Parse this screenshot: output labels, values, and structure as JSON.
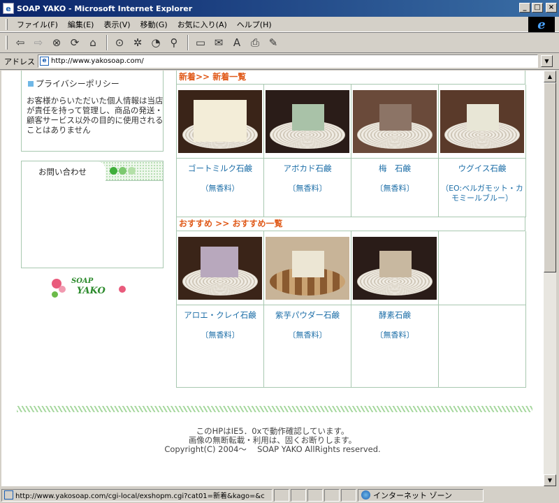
{
  "window": {
    "title": "SOAP YAKO - Microsoft Internet Explorer",
    "min_label": "_",
    "max_label": "□",
    "close_label": "×"
  },
  "menu": [
    "ファイル(F)",
    "編集(E)",
    "表示(V)",
    "移動(G)",
    "お気に入り(A)",
    "ヘルプ(H)"
  ],
  "toolbar_icons": [
    "back-icon",
    "forward-icon",
    "stop-icon",
    "refresh-icon",
    "home-icon",
    "search-icon",
    "favorites-icon",
    "history-icon",
    "channels-icon",
    "fullscreen-icon",
    "mail-icon",
    "font-icon",
    "print-icon",
    "edit-icon"
  ],
  "address": {
    "label": "アドレス",
    "url": "http://www.yakosoap.com/"
  },
  "sidebar": {
    "privacy_title": "プライバシーポリシー",
    "privacy_text": "お客様からいただいた個人情報は当店が責任を持って管理し、商品の発送・顧客サービス以外の目的に使用されることはありません",
    "contact_title": "お問い合わせ",
    "logo_top": "SOAP",
    "logo_bottom": "YAKO"
  },
  "sections": [
    {
      "title": "新着>> 新着一覧",
      "products": [
        {
          "name": "ゴートミルク石鹸",
          "note": "（無香料）",
          "soap_color": "#f3edd8"
        },
        {
          "name": "アボカド石鹸",
          "note": "〔無香料〕",
          "soap_color": "#a9c2a8"
        },
        {
          "name": "梅　石鹸",
          "note": "〔無香料〕",
          "soap_color": "#8c7466"
        },
        {
          "name": "ウグイス石鹸",
          "note": "（EO:ベルガモット・カモミールブルー）",
          "soap_color": "#e8e6d6"
        }
      ]
    },
    {
      "title": "おすすめ >> おすすめ一覧",
      "products": [
        {
          "name": "アロエ・クレイ石鹸",
          "note": "〔無香料〕",
          "soap_color": "#b8a8bd"
        },
        {
          "name": "紫芋パウダー石鹸",
          "note": "〔無香料〕",
          "soap_color": "#ece6d4"
        },
        {
          "name": "酵素石鹸",
          "note": "〔無香料〕",
          "soap_color": "#c8b8a0"
        }
      ]
    }
  ],
  "footer": {
    "line1": "このHPはIE5．0xで動作確認しています。",
    "line2": "画像の無断転載・利用は、固くお断りします。",
    "line3": "Copyright(C) 2004～　 SOAP YAKO  AllRights reserved."
  },
  "status": {
    "url": "http://www.yakosoap.com/cgi-local/exshopm.cgi?cat01=新着&kago=&c",
    "zone": "インターネット ゾーン"
  },
  "colors": {
    "section_title": "#e05a1a",
    "product_text": "#1e6fa8",
    "border": "#a8c8b0"
  }
}
